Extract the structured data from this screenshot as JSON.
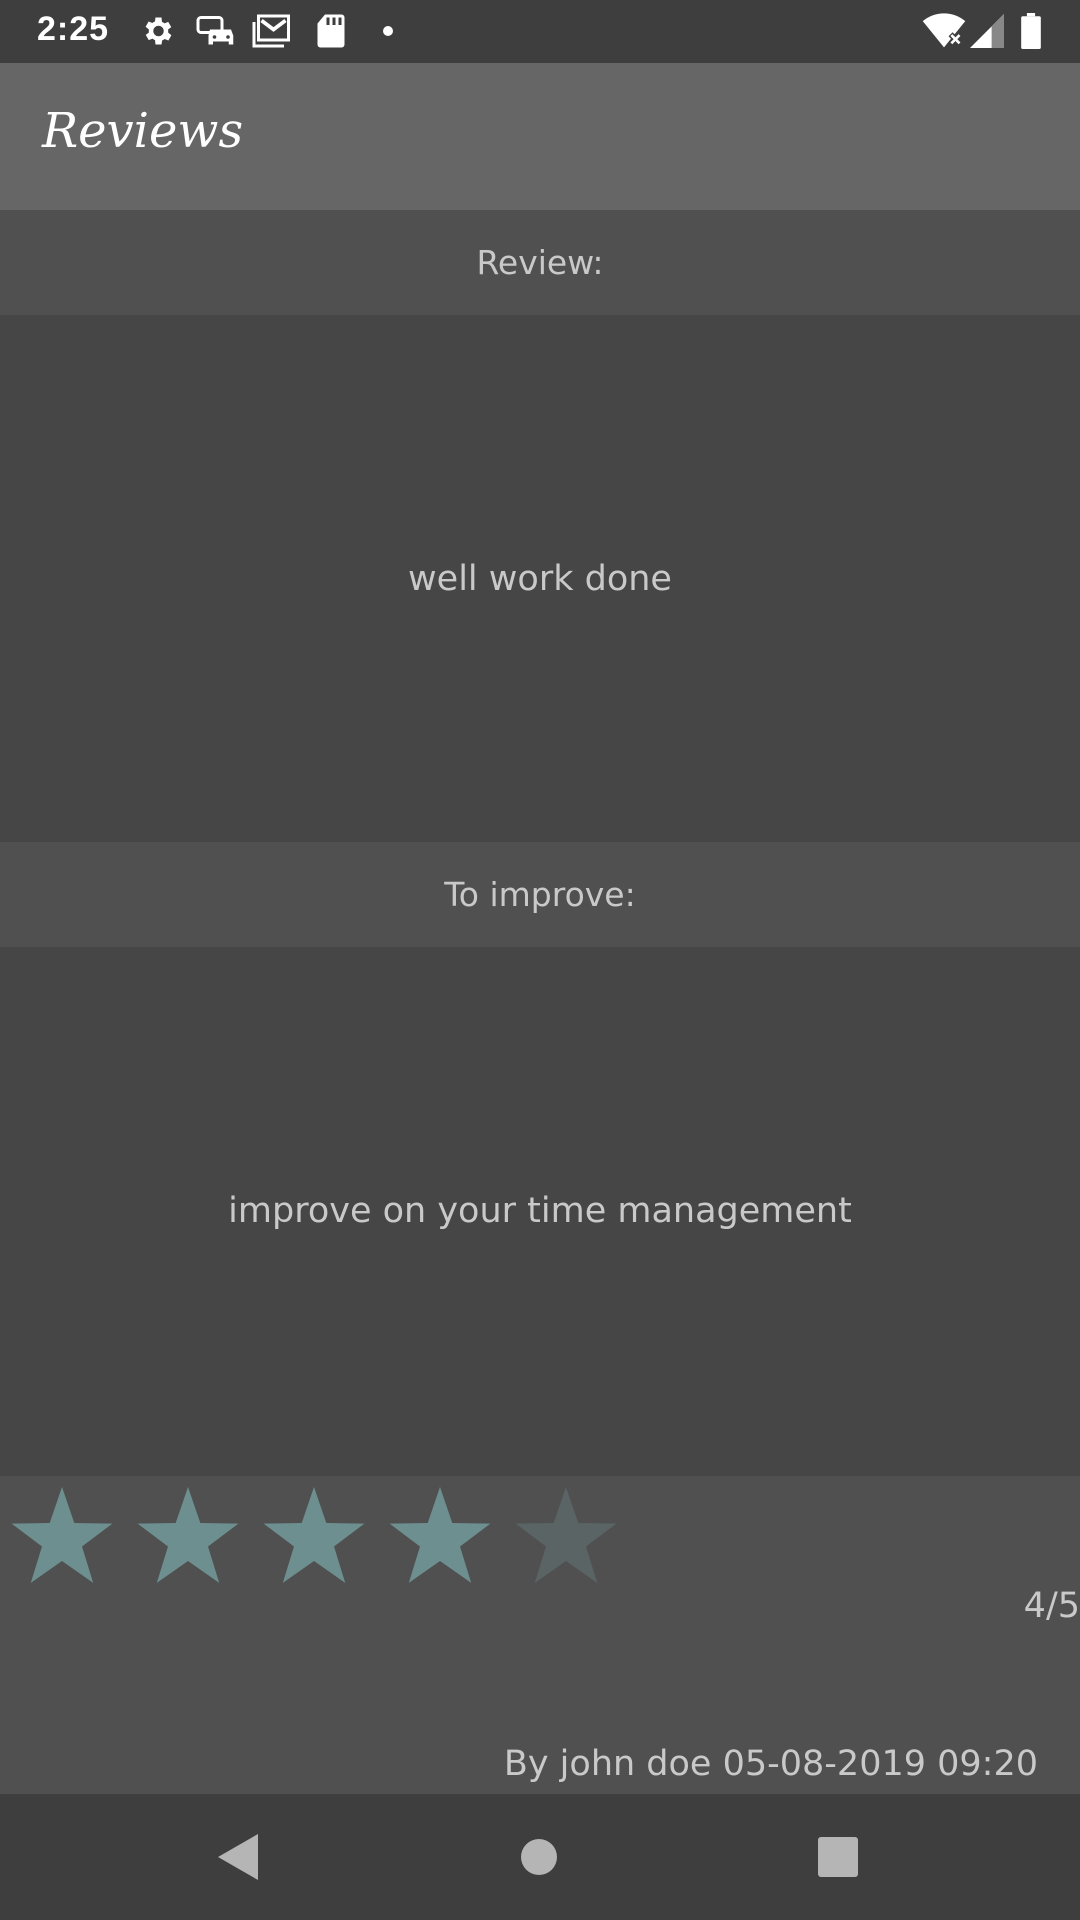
{
  "status_bar": {
    "time": "2:25",
    "icons": [
      "gear-icon",
      "car-sync-icon",
      "gmail-icon",
      "sd-card-icon",
      "dot-icon",
      "wifi-icon",
      "signal-icon",
      "battery-icon"
    ]
  },
  "app_bar": {
    "title": "Reviews"
  },
  "review": {
    "header": "Review:",
    "text": "well work done"
  },
  "improve": {
    "header": "To improve:",
    "text": "improve on your time management"
  },
  "rating": {
    "value": 4,
    "max": 5,
    "label": "4/5",
    "filled_color": "#6e8f8f",
    "empty_color": "#5a6464"
  },
  "author": {
    "text": "By john doe 05-08-2019 09:20"
  },
  "nav": {
    "buttons": [
      "back-icon",
      "home-icon",
      "recents-icon"
    ]
  }
}
